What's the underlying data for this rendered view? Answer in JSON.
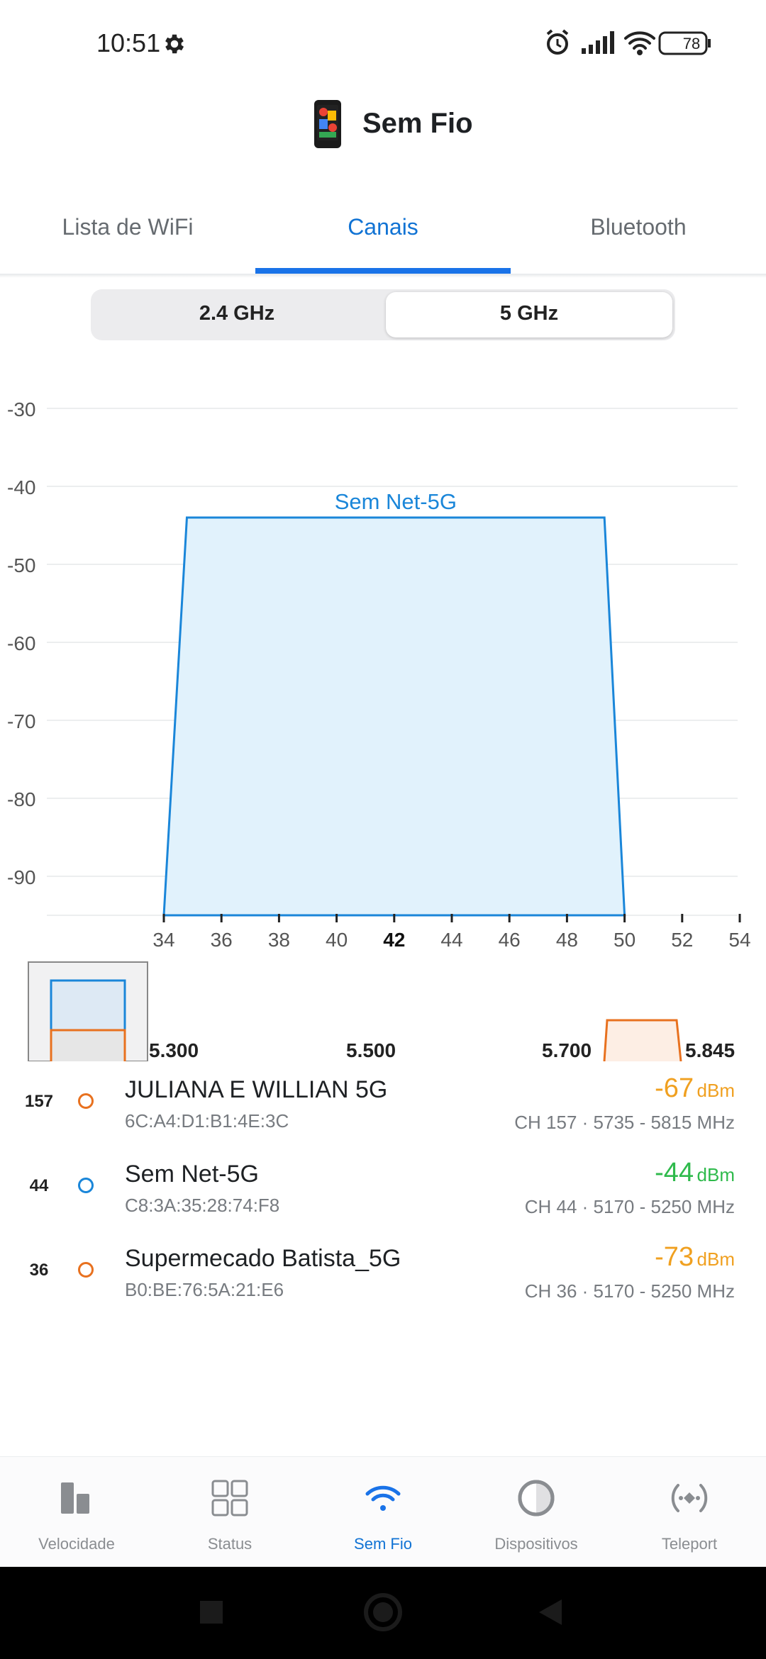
{
  "status_bar": {
    "time": "10:51",
    "battery": "78"
  },
  "app": {
    "title": "Sem Fio"
  },
  "tabs": [
    {
      "label": "Lista de WiFi",
      "active": false
    },
    {
      "label": "Canais",
      "active": true
    },
    {
      "label": "Bluetooth",
      "active": false
    }
  ],
  "band_selector": {
    "options": [
      {
        "label": "2.4 GHz",
        "active": false
      },
      {
        "label": "5 GHz",
        "active": true
      }
    ]
  },
  "chart_data": {
    "type": "area",
    "y_ticks": [
      -30,
      -40,
      -50,
      -60,
      -70,
      -80,
      -90
    ],
    "ylim": [
      -95,
      -28
    ],
    "x_ticks": [
      "34",
      "36",
      "38",
      "40",
      "42",
      "44",
      "46",
      "48",
      "50",
      "52",
      "54"
    ],
    "xlim": [
      33.5,
      54
    ],
    "highlight_tick": "42",
    "grid": true,
    "series": [
      {
        "name": "Supermecado Batista_5G",
        "start": 34,
        "end": 50,
        "top_start": 34.8,
        "top_end": 49.3,
        "dbm": -73,
        "color": "#e8711f",
        "fill": "#e8e7e6"
      },
      {
        "name": "Sem Net-5G",
        "start": 34,
        "end": 50,
        "top_start": 34.8,
        "top_end": 49.3,
        "dbm": -44,
        "color": "#1a86d9",
        "fill": "#e1f2fc"
      }
    ]
  },
  "overview": {
    "labels": [
      "5.300",
      "5.500",
      "5.700",
      "5.845"
    ]
  },
  "networks": [
    {
      "channel": "157",
      "ssid": "JULIANA E WILLIAN 5G",
      "mac": "6C:A4:D1:B1:4E:3C",
      "dbm": "-67",
      "unit": "dBm",
      "detail": "CH 157 · 5735 - 5815 MHz",
      "signal_color": "#f0a020",
      "dot_color": "#e8711f"
    },
    {
      "channel": "44",
      "ssid": "Sem Net-5G",
      "mac": "C8:3A:35:28:74:F8",
      "dbm": "-44",
      "unit": "dBm",
      "detail": "CH 44 · 5170 - 5250 MHz",
      "signal_color": "#2fba4c",
      "dot_color": "#1a86d9"
    },
    {
      "channel": "36",
      "ssid": "Supermecado Batista_5G",
      "mac": "B0:BE:76:5A:21:E6",
      "dbm": "-73",
      "unit": "dBm",
      "detail": "CH 36 · 5170 - 5250 MHz",
      "signal_color": "#f0a020",
      "dot_color": "#e8711f"
    }
  ],
  "bottom_nav": [
    {
      "label": "Velocidade",
      "icon": "bar-chart-icon",
      "active": false
    },
    {
      "label": "Status",
      "icon": "grid-icon",
      "active": false
    },
    {
      "label": "Sem Fio",
      "icon": "wifi-icon",
      "active": true
    },
    {
      "label": "Dispositivos",
      "icon": "circle-icon",
      "active": false
    },
    {
      "label": "Teleport",
      "icon": "teleport-icon",
      "active": false
    }
  ],
  "colors": {
    "accent": "#1a73e8",
    "blue_series": "#1a86d9",
    "orange_series": "#e8711f"
  }
}
